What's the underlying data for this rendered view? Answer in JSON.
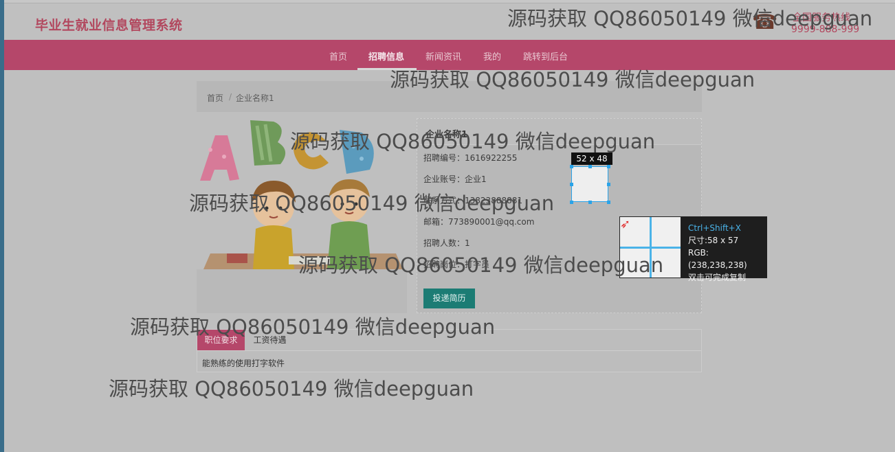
{
  "header": {
    "brand": "毕业生就业信息管理系统",
    "hotline_label": "全国服务热线",
    "hotline_number": "9999-888-999"
  },
  "nav": {
    "items": [
      "首页",
      "招聘信息",
      "新闻资讯",
      "我的",
      "跳转到后台"
    ],
    "active": "招聘信息"
  },
  "breadcrumb": {
    "home": "首页",
    "sep": "/",
    "current": "企业名称1"
  },
  "detail": {
    "company_name": "企业名称1",
    "rows": [
      {
        "label": "招聘编号：",
        "value": "1616922255"
      },
      {
        "label": "企业账号：",
        "value": "企业1"
      },
      {
        "label": "联系方式：",
        "value": "13823888881"
      },
      {
        "label": "邮箱：",
        "value": "773890001@qq.com"
      },
      {
        "label": "招聘人数：",
        "value": "1"
      },
      {
        "label": "招聘岗位：",
        "value": "打字员"
      }
    ],
    "apply_button": "投递简历"
  },
  "tabs": {
    "items": [
      "职位要求",
      "工资待遇"
    ],
    "active": "职位要求",
    "content": "能熟练的使用打字软件"
  },
  "screenshot_tool": {
    "size_label": "52 x 48",
    "shortcut": "Ctrl+Shift+X",
    "size": "尺寸:58 x 57",
    "rgb": "RGB:(238,238,238)",
    "hint": "双击可完成复制"
  },
  "watermark": "源码获取 QQ86050149 微信deepguan",
  "colors": {
    "brand": "#b2475e",
    "nav_bg": "#b5476a",
    "button": "#1c7c74",
    "selection": "#2aa3e8"
  }
}
